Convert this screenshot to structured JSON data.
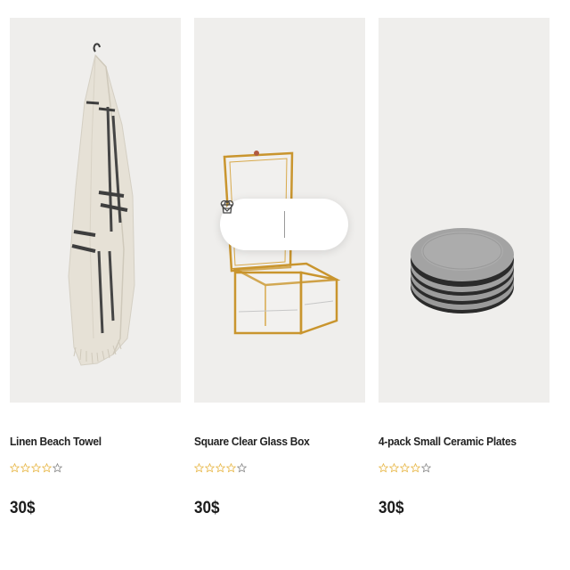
{
  "products": [
    {
      "name": "Linen Beach Towel",
      "price": "30$",
      "rating": 4,
      "rating_max": 5
    },
    {
      "name": "Square Clear Glass Box",
      "price": "30$",
      "rating": 4,
      "rating_max": 5
    },
    {
      "name": "4-pack Small Ceramic Plates",
      "price": "30$",
      "rating": 4,
      "rating_max": 5
    }
  ],
  "hover_actions": {
    "icons": [
      "shopping-bag-icon",
      "heart-icon"
    ]
  },
  "colors": {
    "star_filled": "#e8b84a",
    "star_empty": "#8a8a8a",
    "image_bg": "#efeeec"
  }
}
